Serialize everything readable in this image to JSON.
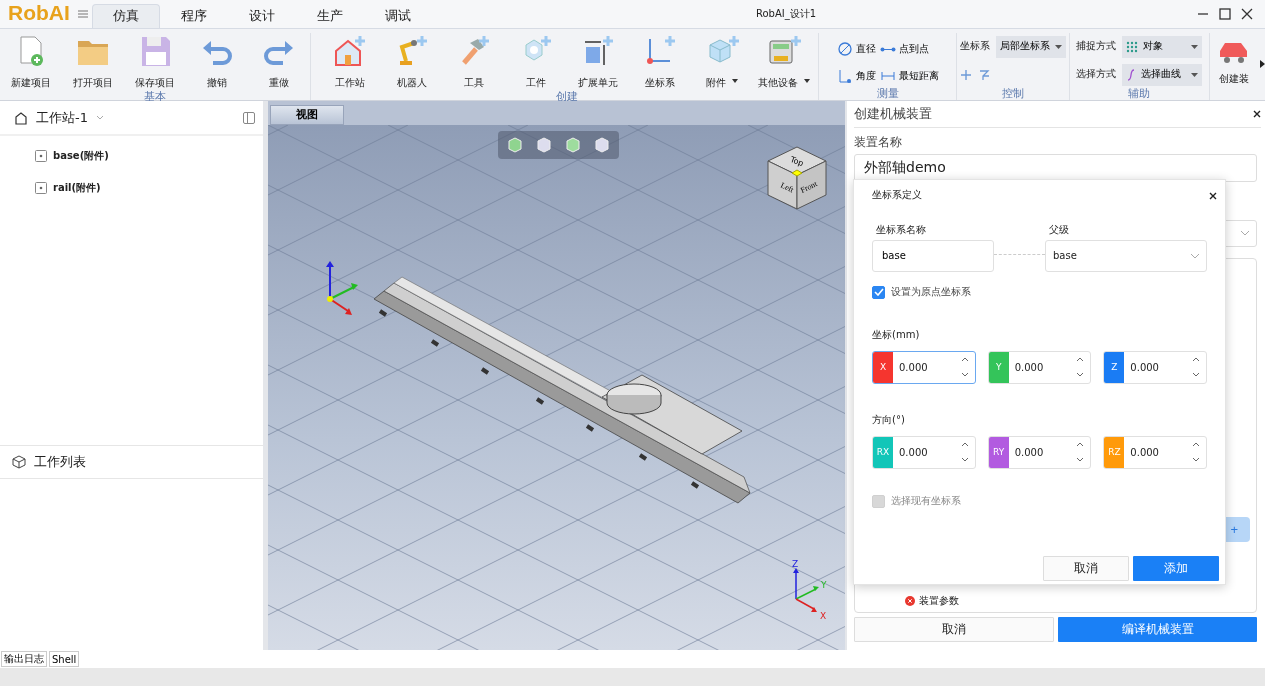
{
  "app": {
    "logo": "RobAI",
    "title": "RobAI_设计1"
  },
  "menu_tabs": [
    {
      "label": "仿真",
      "selected": true
    },
    {
      "label": "程序",
      "selected": false
    },
    {
      "label": "设计",
      "selected": false
    },
    {
      "label": "生产",
      "selected": false
    },
    {
      "label": "调试",
      "selected": false
    }
  ],
  "ribbon": {
    "basic": {
      "label": "基本",
      "buttons": [
        {
          "label": "新建项目",
          "dropdown": false
        },
        {
          "label": "打开项目",
          "dropdown": false
        },
        {
          "label": "保存项目",
          "dropdown": false
        },
        {
          "label": "撤销",
          "dropdown": false
        },
        {
          "label": "重做",
          "dropdown": false
        }
      ]
    },
    "create": {
      "label": "创建",
      "buttons": [
        {
          "label": "工作站",
          "dropdown": false
        },
        {
          "label": "机器人",
          "dropdown": false
        },
        {
          "label": "工具",
          "dropdown": false
        },
        {
          "label": "工件",
          "dropdown": false
        },
        {
          "label": "扩展单元",
          "dropdown": false
        },
        {
          "label": "坐标系",
          "dropdown": false
        },
        {
          "label": "附件",
          "dropdown": true
        },
        {
          "label": "其他设备",
          "dropdown": true
        }
      ]
    },
    "measure": {
      "label": "测量",
      "buttons": [
        "直径",
        "点到点",
        "角度",
        "最短距离"
      ]
    },
    "control": {
      "label": "控制",
      "frame_label": "坐标系",
      "frame_value": "局部坐标系"
    },
    "assist": {
      "label": "辅助",
      "snap_label": "捕捉方式",
      "snap_value": "对象",
      "select_label": "选择方式",
      "select_value": "选择曲线"
    },
    "cut_button": "创建装"
  },
  "tree": {
    "station": "工作站-1",
    "items": [
      {
        "label": "base(附件)"
      },
      {
        "label": "rail(附件)"
      }
    ],
    "work_list": "工作列表"
  },
  "viewport": {
    "tab": "视图",
    "cube_labels": [
      "Top",
      "Left",
      "Front"
    ],
    "axis_labels": [
      "Z",
      "Y",
      "X"
    ]
  },
  "panel": {
    "title": "创建机械装置",
    "name_label": "装置名称",
    "name_value": "外部轴demo",
    "add_button": "+",
    "param_item": "装置参数",
    "cancel": "取消",
    "compile": "编译机械装置"
  },
  "dialog": {
    "title": "坐标系定义",
    "name_label": "坐标系名称",
    "name_value": "base",
    "parent_label": "父级",
    "parent_value": "base",
    "origin_checkbox": {
      "label": "设置为原点坐标系",
      "checked": true,
      "disabled": false
    },
    "coords_label": "坐标(mm)",
    "coords": [
      {
        "axis": "X",
        "value": "0.000",
        "color": "#f5352f",
        "focused": true
      },
      {
        "axis": "Y",
        "value": "0.000",
        "color": "#34c45a",
        "focused": false
      },
      {
        "axis": "Z",
        "value": "0.000",
        "color": "#1a7cf4",
        "focused": false
      }
    ],
    "orientation_label": "方向(°)",
    "orientation": [
      {
        "axis": "RX",
        "value": "0.000",
        "color": "#12c6b8",
        "focused": false
      },
      {
        "axis": "RY",
        "value": "0.000",
        "color": "#b25be0",
        "focused": false
      },
      {
        "axis": "RZ",
        "value": "0.000",
        "color": "#ff9a0a",
        "focused": false
      }
    ],
    "existing_checkbox": {
      "label": "选择现有坐标系",
      "checked": false,
      "disabled": true
    },
    "cancel": "取消",
    "add": "添加"
  },
  "bottom_tabs": [
    "输出日志",
    "Shell"
  ]
}
